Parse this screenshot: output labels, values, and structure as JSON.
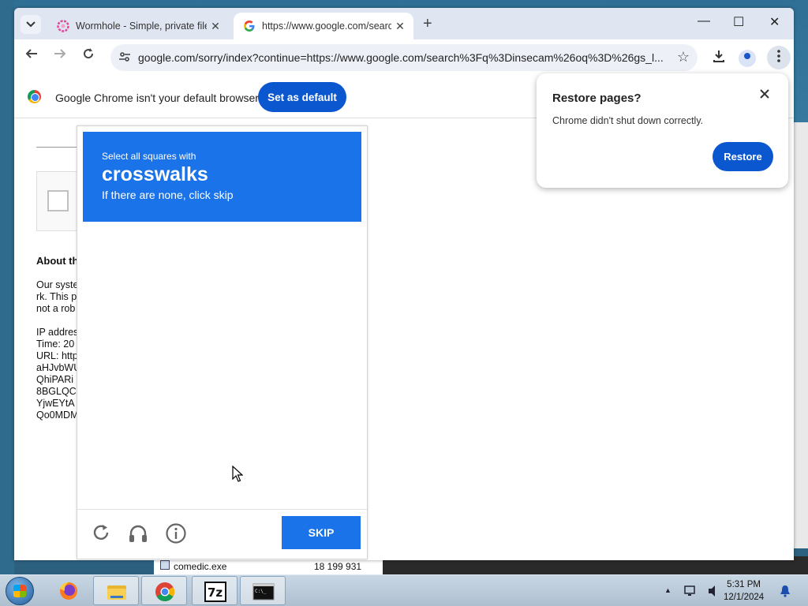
{
  "browser": {
    "tabs": [
      {
        "title": "Wormhole - Simple, private file",
        "close": "✕"
      },
      {
        "title": "https://www.google.com/search",
        "close": "✕"
      }
    ],
    "new_tab": "+",
    "window_controls": {
      "minimize": "—",
      "maximize": "☐",
      "close": "✕"
    },
    "url": "google.com/sorry/index?continue=https://www.google.com/search%3Fq%3Dinsecam%26oq%3D%26gs_l..."
  },
  "infobar": {
    "message": "Google Chrome isn't your default browser",
    "button": "Set as default"
  },
  "page": {
    "about_heading": "About th",
    "text_lines": [
      "Our syste",
      "rk. This p",
      "not a rob",
      "",
      "IP addres",
      "Time: 20",
      "URL: http",
      "aHJvbWU",
      "QhiPARi",
      "8BGLQC",
      "YjwEYtA",
      "Qo0MDM"
    ]
  },
  "captcha": {
    "select_text": "Select all squares with",
    "object": "crosswalks",
    "hint": "If there are none, click skip",
    "skip_label": "SKIP"
  },
  "restore_dialog": {
    "title": "Restore pages?",
    "message": "Chrome didn't shut down correctly.",
    "button": "Restore"
  },
  "background_window": {
    "file_name": "comedic.exe",
    "file_size": "18 199 931"
  },
  "taskbar": {
    "time": "5:31 PM",
    "date": "12/1/2024",
    "apps": [
      "firefox-icon",
      "file-explorer-icon",
      "chrome-icon",
      "7zip-icon",
      "cmd-icon"
    ],
    "zip_label": "7z",
    "cmd_label": "C:\\_"
  }
}
